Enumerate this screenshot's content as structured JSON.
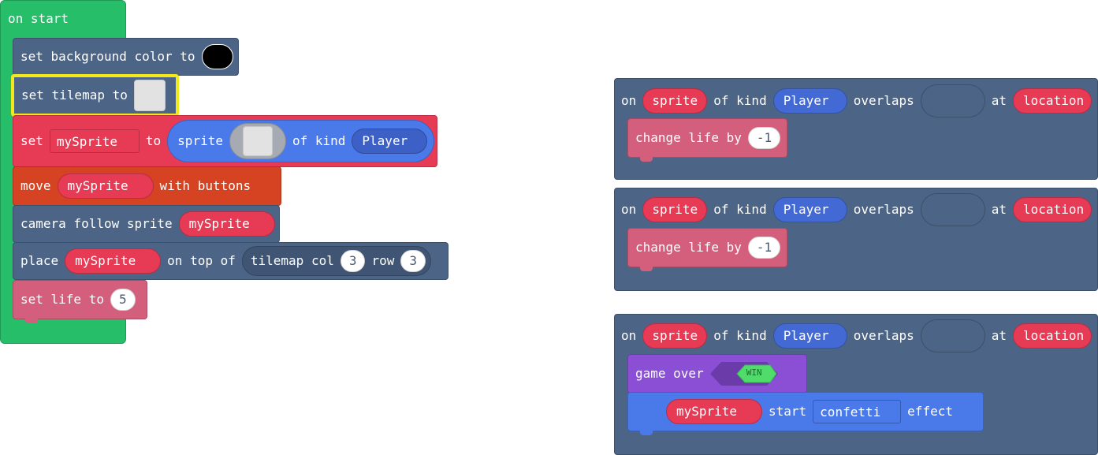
{
  "colors": {
    "green": "#27be6a",
    "slate": "#4c6485",
    "red": "#e63a55",
    "orange": "#d54322",
    "pink": "#d45f7c",
    "purple": "#8a4fd4",
    "blue": "#4a7ae9",
    "highlight": "#f3e81a"
  },
  "on_start": {
    "hat_label": "on start",
    "bg_color": {
      "label": "set background color to",
      "value_color": "#000000"
    },
    "tilemap": {
      "label": "set tilemap to",
      "icon": "tilemap-image-icon"
    },
    "set_sprite": {
      "set_label": "set",
      "var": "mySprite",
      "to_label": "to",
      "sprite_label": "sprite",
      "image_icon": "sprite-image-icon",
      "kind_label": "of kind",
      "kind": "Player"
    },
    "move": {
      "label": "move",
      "var": "mySprite",
      "suffix": "with buttons"
    },
    "camera": {
      "label": "camera follow sprite",
      "var": "mySprite"
    },
    "place": {
      "label": "place",
      "var": "mySprite",
      "on_top": "on top of",
      "tilemap_label": "tilemap col",
      "col": "3",
      "row_label": "row",
      "row": "3"
    },
    "set_life": {
      "label": "set life to",
      "value": "5"
    }
  },
  "overlap_handlers": [
    {
      "on_label": "on",
      "sprite_var": "sprite",
      "kind_label": "of kind",
      "kind": "Player",
      "overlaps_label": "overlaps",
      "at_label": "at",
      "location_var": "location",
      "body": {
        "label": "change life by",
        "value": "-1"
      }
    },
    {
      "on_label": "on",
      "sprite_var": "sprite",
      "kind_label": "of kind",
      "kind": "Player",
      "overlaps_label": "overlaps",
      "at_label": "at",
      "location_var": "location",
      "body": {
        "label": "change life by",
        "value": "-1"
      }
    },
    {
      "on_label": "on",
      "sprite_var": "sprite",
      "kind_label": "of kind",
      "kind": "Player",
      "overlaps_label": "overlaps",
      "at_label": "at",
      "location_var": "location",
      "game_over": {
        "label": "game over",
        "win": "WIN"
      },
      "effect": {
        "var": "mySprite",
        "start_label": "start",
        "effect": "confetti",
        "suffix": "effect"
      }
    }
  ]
}
